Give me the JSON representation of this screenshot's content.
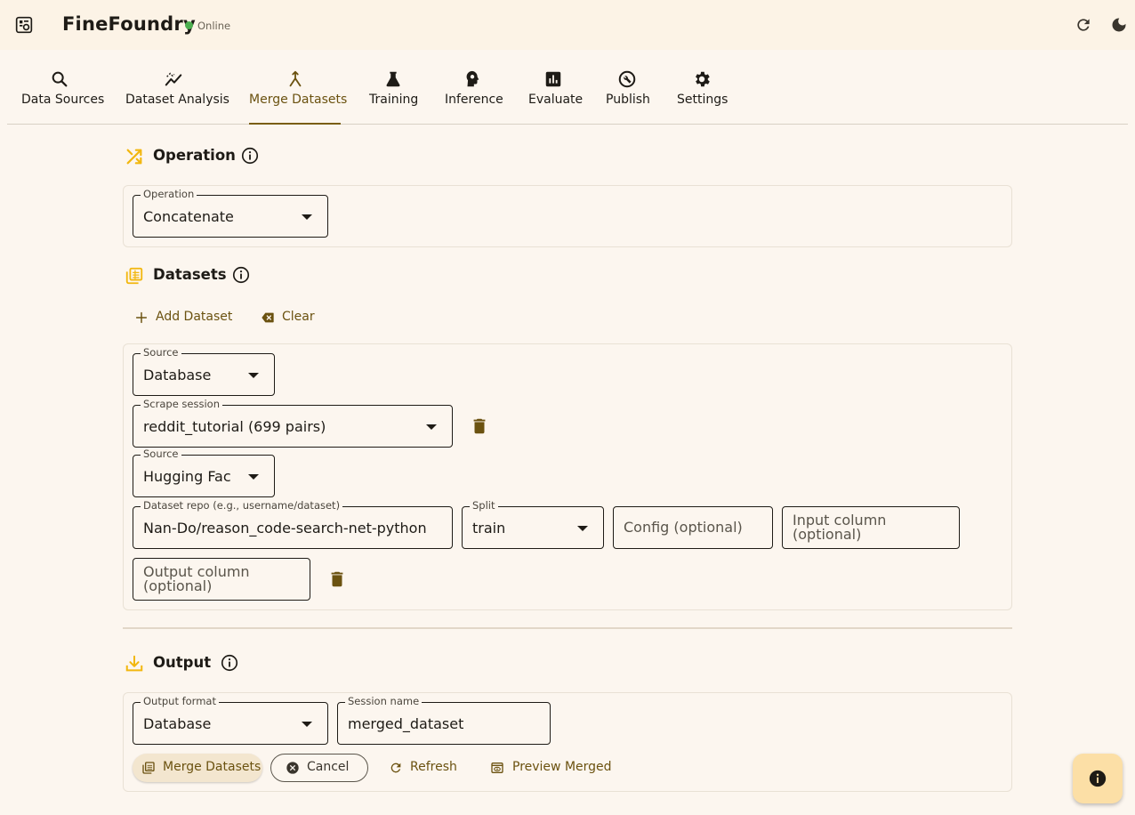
{
  "app": {
    "title": "FineFoundry",
    "status": "Online"
  },
  "tabs": [
    {
      "label": "Data Sources",
      "icon": "search-icon"
    },
    {
      "label": "Dataset Analysis",
      "icon": "analytics-icon"
    },
    {
      "label": "Merge Datasets",
      "icon": "merge-icon",
      "active": true
    },
    {
      "label": "Training",
      "icon": "flask-icon"
    },
    {
      "label": "Inference",
      "icon": "psychology-icon"
    },
    {
      "label": "Evaluate",
      "icon": "bar-chart-icon"
    },
    {
      "label": "Publish",
      "icon": "publish-icon"
    },
    {
      "label": "Settings",
      "icon": "gear-icon"
    }
  ],
  "operation": {
    "title": "Operation",
    "field_label": "Operation",
    "value": "Concatenate"
  },
  "datasets": {
    "title": "Datasets",
    "add_label": "Add Dataset",
    "clear_label": "Clear",
    "entry1": {
      "source_label": "Source",
      "source_value": "Database",
      "session_label": "Scrape session",
      "session_value": "reddit_tutorial (699 pairs)"
    },
    "entry2": {
      "source_label": "Source",
      "source_value": "Hugging Face",
      "repo_label": "Dataset repo (e.g., username/dataset)",
      "repo_value": "Nan-Do/reason_code-search-net-python",
      "split_label": "Split",
      "split_value": "train",
      "config_placeholder": "Config (optional)",
      "input_col_placeholder": "Input column (optional)",
      "output_col_placeholder": "Output column (optional)"
    }
  },
  "output": {
    "title": "Output",
    "format_label": "Output format",
    "format_value": "Database",
    "session_label": "Session name",
    "session_value": "merged_dataset",
    "buttons": {
      "merge": "Merge Datasets",
      "cancel": "Cancel",
      "refresh": "Refresh",
      "preview": "Preview Merged"
    }
  },
  "colors": {
    "accent": "#7a5e10",
    "icon_gold": "#f2b70f",
    "background": "#fcf6ef",
    "appbar": "#fcf3e6",
    "status_green": "#4caf50",
    "fab": "#fcdfa6"
  }
}
